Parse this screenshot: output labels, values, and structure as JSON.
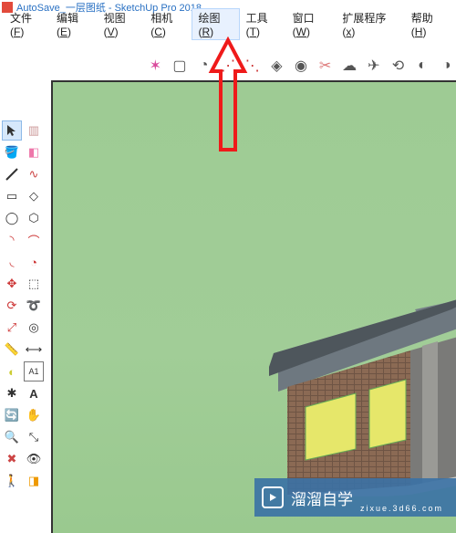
{
  "title": "AutoSave_一层图纸 - SketchUp Pro 2018",
  "menu": [
    {
      "label": "文件",
      "hotkey": "F"
    },
    {
      "label": "编辑",
      "hotkey": "E"
    },
    {
      "label": "视图",
      "hotkey": "V"
    },
    {
      "label": "相机",
      "hotkey": "C"
    },
    {
      "label": "绘图",
      "hotkey": "R",
      "active": true
    },
    {
      "label": "工具",
      "hotkey": "T"
    },
    {
      "label": "窗口",
      "hotkey": "W"
    },
    {
      "label": "扩展程序",
      "hotkey": "x"
    },
    {
      "label": "帮助",
      "hotkey": "H"
    }
  ],
  "colors": {
    "viewport_bg": "#a2ce97",
    "roof": "#6b767e",
    "wall_brick": "#8c6b56",
    "window_glow": "#e7e96a",
    "arrow": "#f41a1a"
  },
  "watermark": {
    "brand": "溜溜自学",
    "sub": "zixue.3d66.com"
  }
}
